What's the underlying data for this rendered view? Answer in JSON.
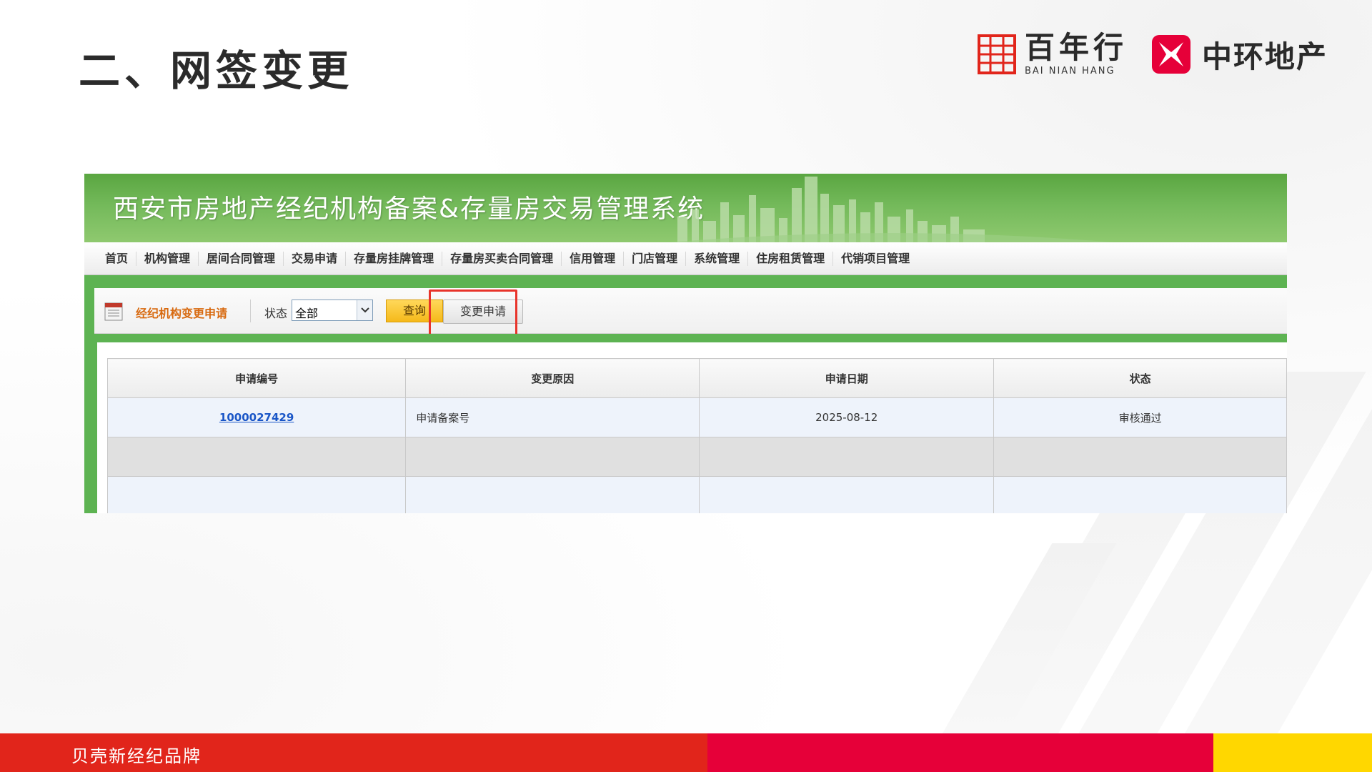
{
  "slide": {
    "title": "二、网签变更",
    "footer_text": "贝壳新经纪品牌"
  },
  "logos": {
    "bnh_cn": "百年行",
    "bnh_en": "BAI NIAN HANG",
    "zh_cn": "中环地产"
  },
  "system": {
    "title": "西安市房地产经纪机构备案&存量房交易管理系统",
    "nav": [
      "首页",
      "机构管理",
      "居间合同管理",
      "交易申请",
      "存量房挂牌管理",
      "存量房买卖合同管理",
      "信用管理",
      "门店管理",
      "系统管理",
      "住房租赁管理",
      "代销项目管理"
    ]
  },
  "toolbar": {
    "section_label": "经纪机构变更申请",
    "state_label": "状态",
    "state_value": "全部",
    "query_label": "查询",
    "change_label": "变更申请"
  },
  "table": {
    "headers": [
      "申请编号",
      "变更原因",
      "申请日期",
      "状态"
    ],
    "rows": [
      {
        "id": "1000027429",
        "reason": "申请备案号",
        "date": "2025-08-12",
        "status": "审核通过"
      }
    ]
  },
  "colors": {
    "accent_green": "#5db352",
    "highlight_red": "#e8342b",
    "footer_red": "#e1251b",
    "footer_crimson": "#e60039",
    "footer_yellow": "#ffd700"
  }
}
